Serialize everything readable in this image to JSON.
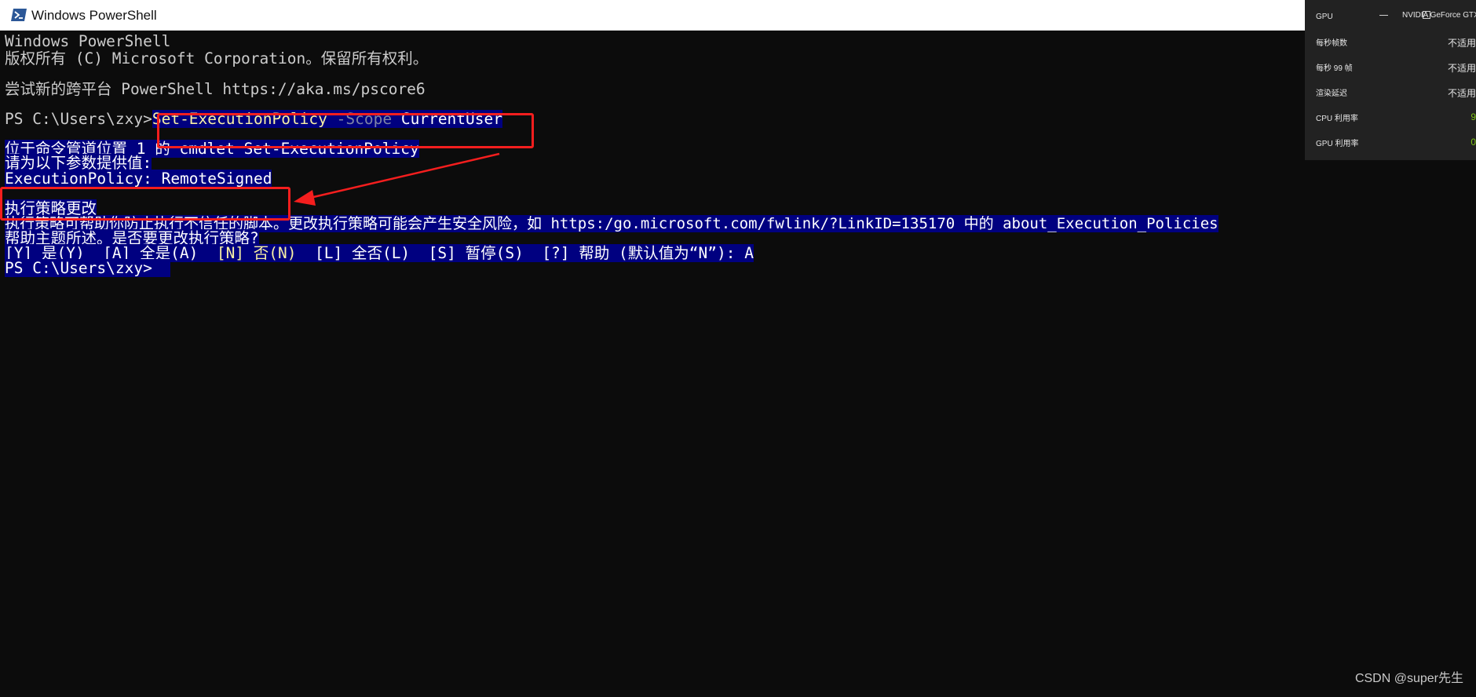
{
  "window": {
    "title": "Windows PowerShell"
  },
  "console": {
    "banner_title": "Windows PowerShell",
    "banner_copyright": "版权所有 (C) Microsoft Corporation。保留所有权利。",
    "banner_tip": "尝试新的跨平台 PowerShell https://aka.ms/pscore6",
    "prompt1": "PS C:\\Users\\zxy>",
    "cmd_name": "Set-ExecutionPolicy",
    "cmd_param": "-Scope",
    "cmd_value": "CurrentUser",
    "info1": "位于命令管道位置 1 的 cmdlet Set-ExecutionPolicy",
    "info2": "请为以下参数提供值:",
    "policy_input": "ExecutionPolicy: RemoteSigned",
    "change_title": "执行策略更改",
    "change_desc1": "执行策略可帮助你防止执行不信任的脚本。更改执行策略可能会产生安全风险，如 https:/go.microsoft.com/fwlink/?LinkID=135170 中的 about_Execution_Policies",
    "change_desc2": "帮助主题所述。是否要更改执行策略?",
    "choices_before": "[Y] 是(Y)  [A] 全是(A)  ",
    "choices_default": "[N] 否(N)",
    "choices_after": "  [L] 全否(L)  [S] 暂停(S)  [?] 帮助 (默认值为“N”): A",
    "prompt2": "PS C:\\Users\\zxy>"
  },
  "overlay": {
    "gpu_label": "GPU",
    "gpu_name": "NVIDIA GeForce GTX",
    "rows": [
      {
        "label": "每秒帧数",
        "value": "不适用"
      },
      {
        "label": "每秒 99 帧",
        "value": "不适用"
      },
      {
        "label": "渲染延迟",
        "value": "不适用"
      },
      {
        "label": "CPU 利用率",
        "value": "9"
      },
      {
        "label": "GPU 利用率",
        "value": "0"
      }
    ],
    "value_green": "#7dc314"
  },
  "colors": {
    "console_bg": "#0c0c0c",
    "selection_bg": "#000080",
    "command_yellow": "#f9f1a5",
    "annotation_red": "#f51e1e"
  },
  "watermark": "CSDN @super先生"
}
